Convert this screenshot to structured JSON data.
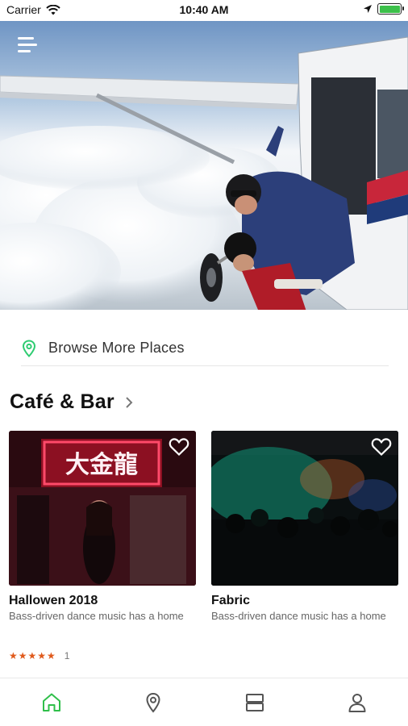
{
  "status_bar": {
    "carrier": "Carrier",
    "time": "10:40 AM",
    "icons": [
      "wifi-icon",
      "location-arrow-icon",
      "battery-icon"
    ],
    "battery_color": "#3cc04a"
  },
  "hero": {
    "menu_icon": "hamburger-menu-icon",
    "image_alt": "Tandem skydivers jumping out of an airplane above clouds"
  },
  "browse": {
    "icon": "map-pin-icon",
    "label": "Browse More Places",
    "accent": "#2ecc71"
  },
  "section": {
    "title": "Café & Bar",
    "chevron": "chevron-right-icon"
  },
  "cards": [
    {
      "title": "Hallowen 2018",
      "description": "Bass-driven dance music has a home",
      "stars": "★★★★★",
      "rating_count": "1",
      "icon": "heart-icon"
    },
    {
      "title": "Fabric",
      "description": "Bass-driven dance music has a home",
      "icon": "heart-icon"
    }
  ],
  "neon_sign": "大金龍",
  "tab_bar": {
    "active_color": "#2fbf4a",
    "inactive_color": "#555555",
    "tabs": [
      "home-icon",
      "map-pin-icon",
      "list-layout-icon",
      "profile-icon"
    ]
  }
}
